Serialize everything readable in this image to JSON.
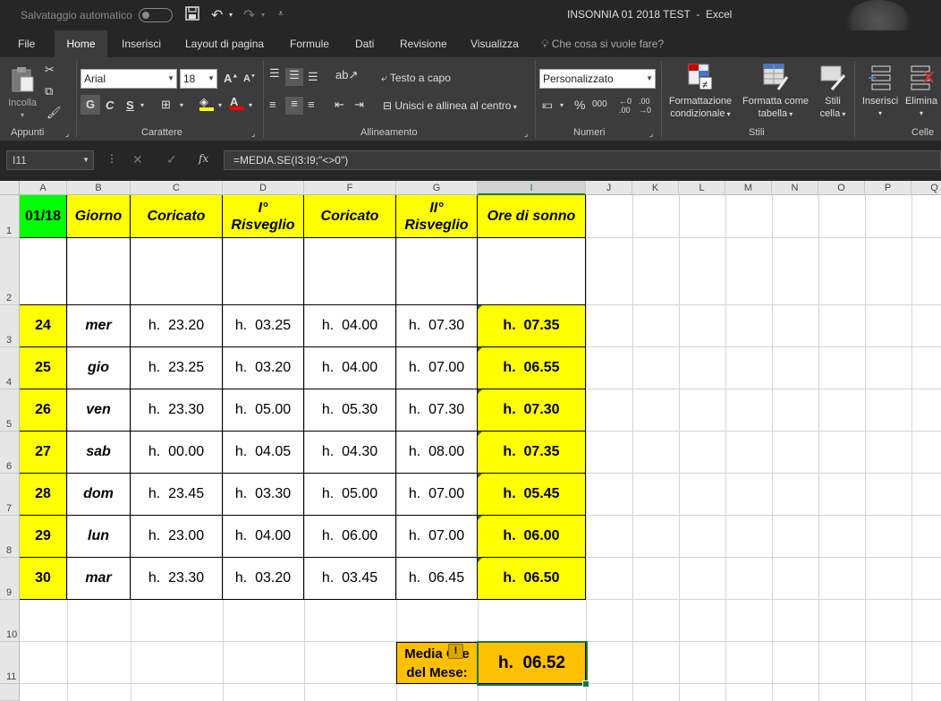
{
  "titlebar": {
    "autosave_label": "Salvataggio automatico",
    "window_title": "INSONNIA 01 2018 TEST  -  Excel"
  },
  "tabs": [
    "File",
    "Home",
    "Inserisci",
    "Layout di pagina",
    "Formule",
    "Dati",
    "Revisione",
    "Visualizza"
  ],
  "active_tab": "Home",
  "tell_me": "Che cosa si vuole fare?",
  "ribbon": {
    "paste_label": "Incolla",
    "font_name": "Arial",
    "font_size": "18",
    "bold": "G",
    "italic": "C",
    "underline": "S",
    "wrap_text": "Testo a capo",
    "merge_center": "Unisci e allinea al centro",
    "number_format": "Personalizzato",
    "percent": "%",
    "thousands": "000",
    "cond_format": [
      "Formattazione",
      "condizionale"
    ],
    "format_table": [
      "Formatta come",
      "tabella"
    ],
    "cell_styles": [
      "Stili",
      "cella"
    ],
    "insert": "Inserisci",
    "delete": "Elimina",
    "groups": [
      "Appunti",
      "Carattere",
      "Allineamento",
      "Numeri",
      "Stili",
      "Celle"
    ]
  },
  "formula_bar": {
    "name_box": "I11",
    "fx": "fx",
    "formula": "=MEDIA.SE(I3:I9;\"<>0\")"
  },
  "columns": [
    "A",
    "B",
    "C",
    "D",
    "F",
    "G",
    "I",
    "J",
    "K",
    "L",
    "M",
    "N",
    "O",
    "P",
    "Q"
  ],
  "rows": [
    "1",
    "2",
    "3",
    "4",
    "5",
    "6",
    "7",
    "8",
    "9",
    "10",
    "11"
  ],
  "sheet": {
    "headers": {
      "a1": "01/18",
      "b1": "Giorno",
      "c1": "Coricato",
      "d1_1": "I°",
      "d1_2": "Risveglio",
      "f1": "Coricato",
      "g1_1": "II°",
      "g1_2": "Risveglio",
      "i1": "Ore di sonno"
    },
    "data_rows": [
      {
        "day": "24",
        "weekday": "mer",
        "c": "h.  23.20",
        "d": "h.  03.25",
        "f": "h.  04.00",
        "g": "h.  07.30",
        "i": "h.  07.35"
      },
      {
        "day": "25",
        "weekday": "gio",
        "c": "h.  23.25",
        "d": "h.  03.20",
        "f": "h.  04.00",
        "g": "h.  07.00",
        "i": "h.  06.55"
      },
      {
        "day": "26",
        "weekday": "ven",
        "c": "h.  23.30",
        "d": "h.  05.00",
        "f": "h.  05.30",
        "g": "h.  07.30",
        "i": "h.  07.30"
      },
      {
        "day": "27",
        "weekday": "sab",
        "c": "h.  00.00",
        "d": "h.  04.05",
        "f": "h.  04.30",
        "g": "h.  08.00",
        "i": "h.  07.35"
      },
      {
        "day": "28",
        "weekday": "dom",
        "c": "h.  23.45",
        "d": "h.  03.30",
        "f": "h.  05.00",
        "g": "h.  07.00",
        "i": "h.  05.45"
      },
      {
        "day": "29",
        "weekday": "lun",
        "c": "h.  23.00",
        "d": "h.  04.00",
        "f": "h.  06.00",
        "g": "h.  07.00",
        "i": "h.  06.00"
      },
      {
        "day": "30",
        "weekday": "mar",
        "c": "h.  23.30",
        "d": "h.  03.20",
        "f": "h.  03.45",
        "g": "h.  06.45",
        "i": "h.  06.50"
      }
    ],
    "summary_label_1": "Media Ore",
    "summary_label_2": "del Mese:",
    "summary_value": "h.  06.52"
  },
  "colors": {
    "yellow": "#ffff00",
    "green": "#00ff00",
    "orange": "#ffc000",
    "excel_green": "#217346"
  }
}
